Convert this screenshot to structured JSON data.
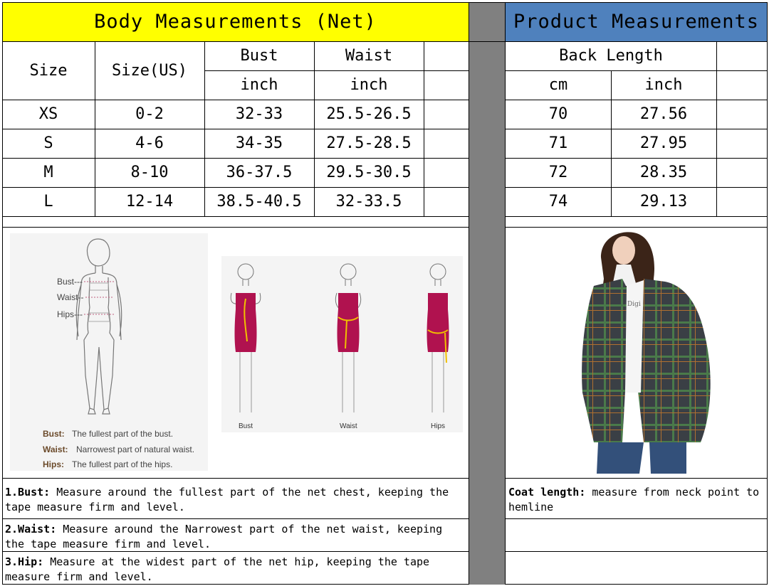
{
  "body_table": {
    "title": "Body Measurements (Net)",
    "headers": {
      "size": "Size",
      "size_us": "Size(US)",
      "bust": "Bust",
      "waist": "Waist",
      "bust_unit": "inch",
      "waist_unit": "inch"
    },
    "rows": [
      {
        "size": "XS",
        "size_us": "0-2",
        "bust": "32-33",
        "waist": "25.5-26.5"
      },
      {
        "size": "S",
        "size_us": "4-6",
        "bust": "34-35",
        "waist": "27.5-28.5"
      },
      {
        "size": "M",
        "size_us": "8-10",
        "bust": "36-37.5",
        "waist": "29.5-30.5"
      },
      {
        "size": "L",
        "size_us": "12-14",
        "bust": "38.5-40.5",
        "waist": "32-33.5"
      }
    ]
  },
  "product_table": {
    "title": "Product Measurements",
    "headers": {
      "back_length": "Back Length",
      "cm": "cm",
      "inch": "inch"
    },
    "rows": [
      {
        "cm": "70",
        "inch": "27.56"
      },
      {
        "cm": "71",
        "inch": "27.95"
      },
      {
        "cm": "72",
        "inch": "28.35"
      },
      {
        "cm": "74",
        "inch": "29.13"
      }
    ]
  },
  "figure_left": {
    "bust_tag": "Bust---",
    "waist_tag": "Waist--",
    "hips_tag": "Hips---",
    "bust_label": "Bust:",
    "bust_desc": "The fullest part of the bust.",
    "waist_label": "Waist:",
    "waist_desc": "Narrowest part of natural waist.",
    "hips_label": "Hips:",
    "hips_desc": "The fullest part of the hips."
  },
  "figure_dress": {
    "bust": "Bust",
    "waist": "Waist",
    "hips": "Hips"
  },
  "notes_left": [
    {
      "label": "1.Bust:",
      "text": " Measure around the fullest part of the net chest, keeping the tape  measure firm and level."
    },
    {
      "label": "2.Waist:",
      "text": " Measure around the Narrowest part of the net waist, keeping the tape  measure firm and level."
    },
    {
      "label": "3.Hip:",
      "text": " Measure at the widest part of the net hip, keeping the tape measure firm and level."
    }
  ],
  "notes_right": [
    {
      "label": "Coat length:",
      "text": " measure from neck point to hemline"
    }
  ],
  "colors": {
    "title_left_bg": "#ffff00",
    "title_right_bg": "#4f81bd",
    "divider": "#808080",
    "dress": "#b0124f"
  }
}
